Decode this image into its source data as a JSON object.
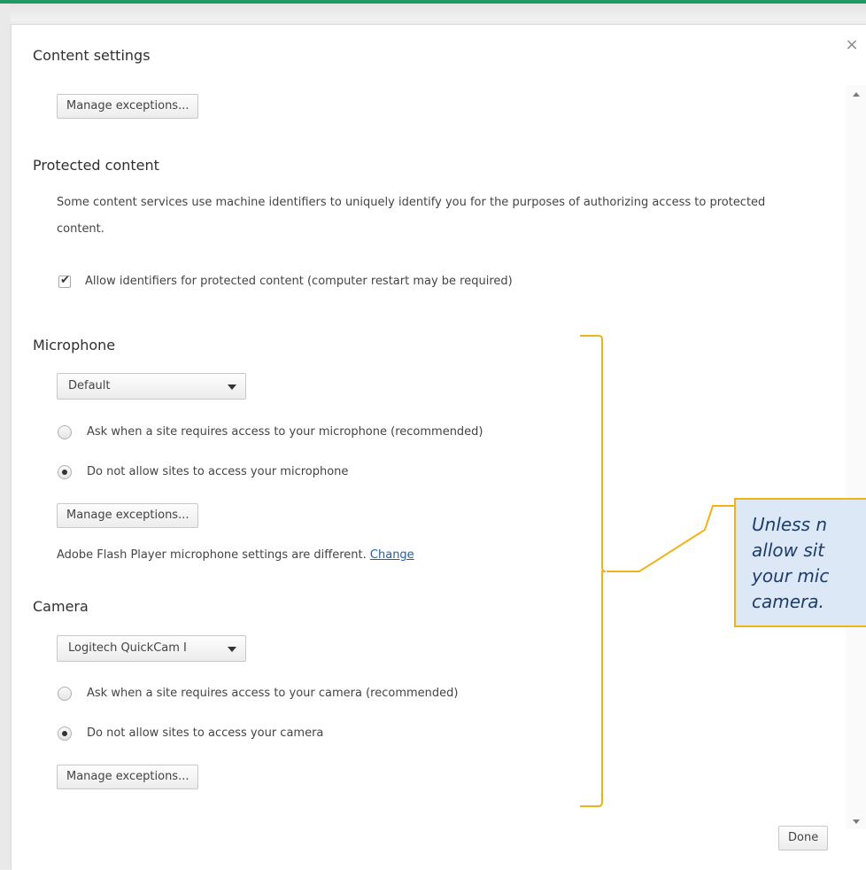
{
  "dialog": {
    "close_icon": "close-icon",
    "title": "Content settings",
    "done_label": "Done"
  },
  "top_section": {
    "manage_exceptions_label": "Manage exceptions..."
  },
  "protected_content": {
    "title": "Protected content",
    "description": "Some content services use machine identifiers to uniquely identify you for the purposes of authorizing access to protected content.",
    "allow_identifiers": {
      "label": "Allow identifiers for protected content (computer restart may be required)",
      "checked": true
    }
  },
  "microphone": {
    "title": "Microphone",
    "selected_device": "Default",
    "options": [
      {
        "label": "Ask when a site requires access to your microphone (recommended)",
        "selected": false
      },
      {
        "label": "Do not allow sites to access your microphone",
        "selected": true
      }
    ],
    "manage_exceptions_label": "Manage exceptions...",
    "flash_note": "Adobe Flash Player microphone settings are different.",
    "flash_link": "Change"
  },
  "camera": {
    "title": "Camera",
    "selected_device": "Logitech QuickCam I",
    "options": [
      {
        "label": "Ask when a site requires access to your camera (recommended)",
        "selected": false
      },
      {
        "label": "Do not allow sites to access your camera",
        "selected": true
      }
    ],
    "manage_exceptions_label": "Manage exceptions..."
  },
  "annotation": {
    "callout_text": "Unless n\nallow sit\nyour mic\ncamera.",
    "bracket_color": "#f2b21a",
    "callout_fill": "#dce8f5"
  },
  "colors": {
    "frame_accent": "#1f9a63",
    "link": "#1a5fb4"
  }
}
